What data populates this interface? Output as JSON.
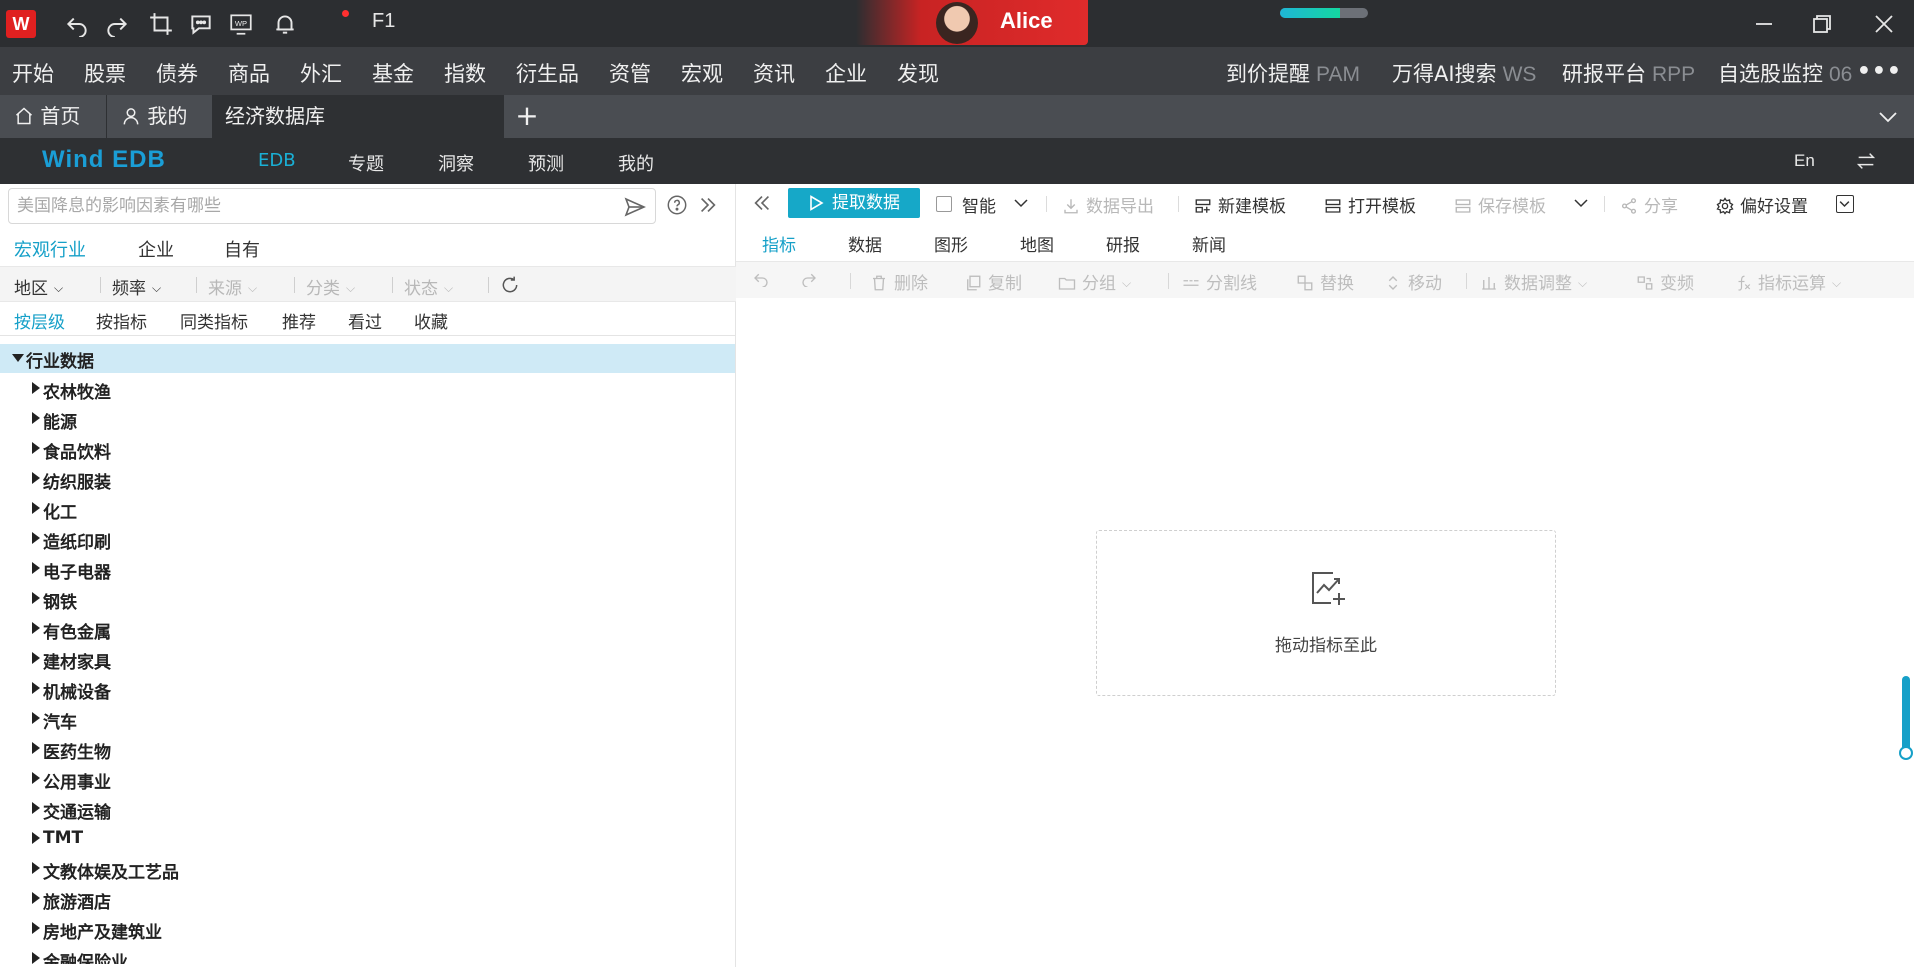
{
  "titlebar": {
    "logo_text": "W",
    "f1_label": "F1",
    "user_name": "Alice",
    "task_progress": 0.68,
    "accent": "#e02020"
  },
  "menu": {
    "items": [
      "开始",
      "股票",
      "债券",
      "商品",
      "外汇",
      "基金",
      "指数",
      "衍生品",
      "资管",
      "宏观",
      "资讯",
      "企业",
      "发现"
    ],
    "right_items": [
      {
        "label": "到价提醒",
        "code": "PAM"
      },
      {
        "label": "万得AI搜索",
        "code": "WS"
      },
      {
        "label": "研报平台",
        "code": "RPP"
      },
      {
        "label": "自选股监控",
        "code": "06"
      }
    ],
    "more": "•••"
  },
  "tabs": {
    "home": "首页",
    "mine": "我的",
    "active": "经济数据库",
    "add": "+"
  },
  "edbnav": {
    "brand": "Wind EDB",
    "items": [
      "EDB",
      "专题",
      "洞察",
      "预测",
      "我的"
    ],
    "lang": "En"
  },
  "left": {
    "search_placeholder": "美国降息的影响因素有哪些",
    "category_tabs": [
      "宏观行业",
      "企业",
      "自有"
    ],
    "filters": {
      "region": "地区",
      "frequency": "频率",
      "source": "来源",
      "category": "分类",
      "status": "状态"
    },
    "sub_tabs": [
      "按层级",
      "按指标",
      "同类指标",
      "推荐",
      "看过",
      "收藏"
    ],
    "tree_root": "行业数据",
    "tree_items": [
      "农林牧渔",
      "能源",
      "食品饮料",
      "纺织服装",
      "化工",
      "造纸印刷",
      "电子电器",
      "钢铁",
      "有色金属",
      "建材家具",
      "机械设备",
      "汽车",
      "医药生物",
      "公用事业",
      "交通运输",
      "TMT",
      "文教体娱及工艺品",
      "旅游酒店",
      "房地产及建筑业",
      "金融保险业"
    ]
  },
  "right": {
    "toolbar": {
      "extract": "提取数据",
      "smart": "智能",
      "export": "数据导出",
      "new_template": "新建模板",
      "open_template": "打开模板",
      "save_template": "保存模板",
      "share": "分享",
      "preferences": "偏好设置"
    },
    "tabs": [
      "指标",
      "数据",
      "图形",
      "地图",
      "研报",
      "新闻"
    ],
    "edit_bar": {
      "delete": "删除",
      "copy": "复制",
      "group": "分组",
      "divider": "分割线",
      "replace": "替换",
      "move": "移动",
      "adjust": "数据调整",
      "transform": "变频",
      "calc": "指标运算"
    },
    "drop_text": "拖动指标至此"
  },
  "colors": {
    "accent_teal": "#16a8c8",
    "title_bg": "#2c2e31",
    "menu_bg": "#3c3e42",
    "selected_row": "#cfeaf6"
  }
}
